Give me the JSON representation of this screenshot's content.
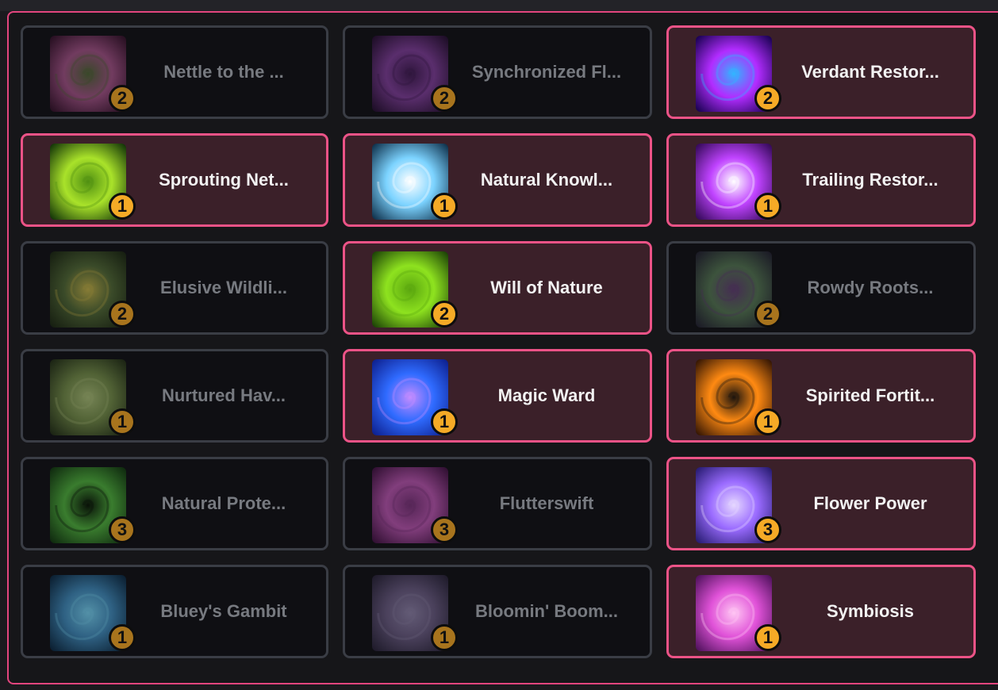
{
  "accent_color": "#ec5387",
  "badge_color": "#f5aa26",
  "cards": [
    {
      "label": "Nettle to the ...",
      "rank": "2",
      "selected": false,
      "icon": "nettle-flower-icon",
      "colors": [
        "#3a1030",
        "#b54e93",
        "#4d6a2e"
      ]
    },
    {
      "label": "Synchronized Fl...",
      "rank": "2",
      "selected": false,
      "icon": "purple-flower-icon",
      "colors": [
        "#2a0f3a",
        "#8f3bb3",
        "#4a1b64"
      ]
    },
    {
      "label": "Verdant Restor...",
      "rank": "2",
      "selected": true,
      "icon": "swirl-orb-icon",
      "colors": [
        "#12004a",
        "#b22cff",
        "#2fb7ff"
      ]
    },
    {
      "label": "Sprouting Net...",
      "rank": "1",
      "selected": true,
      "icon": "green-leaf-icon",
      "colors": [
        "#0c2d06",
        "#a9e22a",
        "#4f8f12"
      ]
    },
    {
      "label": "Natural Knowl...",
      "rank": "1",
      "selected": true,
      "icon": "lightning-tree-icon",
      "colors": [
        "#0a2a44",
        "#7cd3ff",
        "#ffffff"
      ]
    },
    {
      "label": "Trailing Restor...",
      "rank": "1",
      "selected": true,
      "icon": "purple-hands-icon",
      "colors": [
        "#2e0752",
        "#c043ff",
        "#ffffff"
      ]
    },
    {
      "label": "Elusive Wildli...",
      "rank": "2",
      "selected": false,
      "icon": "eyes-in-grass-icon",
      "colors": [
        "#1b2a12",
        "#4e6d2d",
        "#c8b32c"
      ]
    },
    {
      "label": "Will of Nature",
      "rank": "2",
      "selected": true,
      "icon": "green-vortex-icon",
      "colors": [
        "#173b05",
        "#8ee21f",
        "#5aa60f"
      ]
    },
    {
      "label": "Rowdy Roots...",
      "rank": "2",
      "selected": false,
      "icon": "thorn-vine-icon",
      "colors": [
        "#25213a",
        "#4f7a4f",
        "#6b3c84"
      ]
    },
    {
      "label": "Nurtured Hav...",
      "rank": "1",
      "selected": false,
      "icon": "forest-face-icon",
      "colors": [
        "#203014",
        "#6f8f3a",
        "#a5c066"
      ]
    },
    {
      "label": "Magic Ward",
      "rank": "1",
      "selected": true,
      "icon": "magic-scroll-icon",
      "colors": [
        "#0c1d8a",
        "#2f6bff",
        "#c68cff"
      ]
    },
    {
      "label": "Spirited Fortit...",
      "rank": "1",
      "selected": true,
      "icon": "fire-figure-icon",
      "colors": [
        "#2a1003",
        "#ff8a12",
        "#1a130e"
      ]
    },
    {
      "label": "Natural Prote...",
      "rank": "3",
      "selected": false,
      "icon": "bear-shadow-icon",
      "colors": [
        "#0b3a0b",
        "#3cbb26",
        "#0a1a08"
      ]
    },
    {
      "label": "Flutterswift",
      "rank": "3",
      "selected": false,
      "icon": "pink-swirl-icon",
      "colors": [
        "#4a0f4e",
        "#d04fc6",
        "#8a2f8c"
      ]
    },
    {
      "label": "Flower Power",
      "rank": "3",
      "selected": true,
      "icon": "spirit-bloom-icon",
      "colors": [
        "#22186b",
        "#9a6bff",
        "#e6d8ff"
      ]
    },
    {
      "label": "Bluey's Gambit",
      "rank": "1",
      "selected": false,
      "icon": "blue-butterfly-icon",
      "colors": [
        "#06294a",
        "#2f8fd0",
        "#5fd4ff"
      ]
    },
    {
      "label": "Bloomin' Boom...",
      "rank": "1",
      "selected": false,
      "icon": "rock-golem-icon",
      "colors": [
        "#2a2340",
        "#6d5b8e",
        "#8f80b3"
      ]
    },
    {
      "label": "Symbiosis",
      "rank": "1",
      "selected": true,
      "icon": "magenta-swirl-icon",
      "colors": [
        "#4a0f58",
        "#e052d8",
        "#ffc6f3"
      ]
    }
  ]
}
